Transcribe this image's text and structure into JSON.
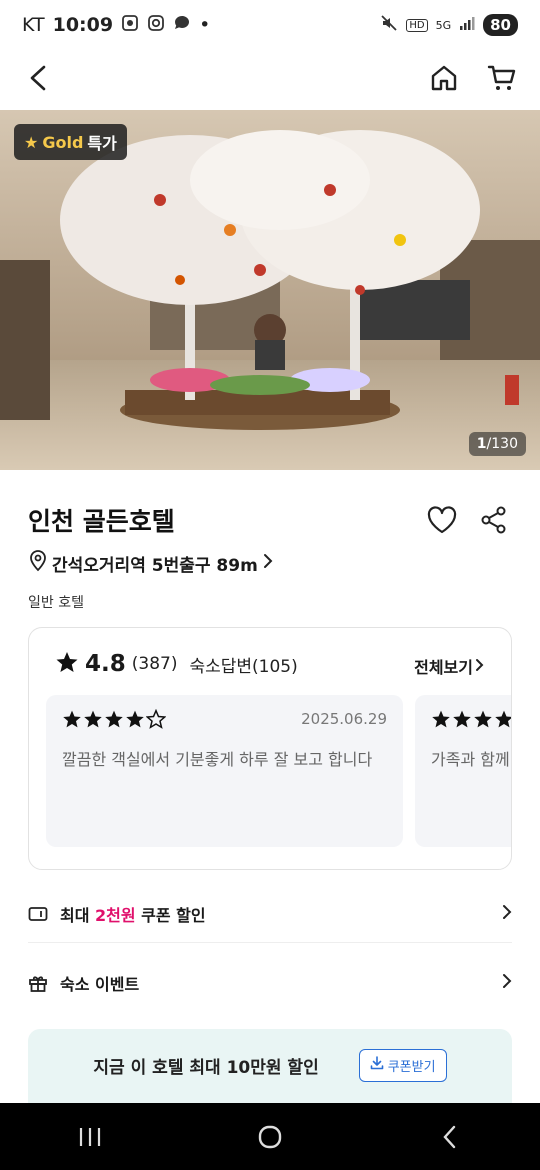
{
  "status_bar": {
    "carrier": "KT",
    "time": "10:09",
    "network": "5G",
    "hd": "HD",
    "battery": "80"
  },
  "nav": {
    "back_icon": "back-arrow-icon",
    "home_icon": "home-icon",
    "cart_icon": "cart-icon"
  },
  "hero": {
    "badge_gold": "Gold",
    "badge_special": "특가",
    "photo_current": "1",
    "photo_total": "/130"
  },
  "hotel": {
    "name": "인천 골든호텔",
    "location": "간석오거리역 5번출구 89m",
    "category": "일반 호텔"
  },
  "reviews": {
    "rating": "4.8",
    "count": "(387)",
    "reply": "숙소답변(105)",
    "see_all": "전체보기",
    "items": [
      {
        "stars": 4,
        "date": "2025.06.29",
        "text": "깔끔한 객실에서 기분좋게 하루 잘 보고 합니다"
      },
      {
        "stars": 4,
        "date": "",
        "text": "가족과 함께"
      }
    ]
  },
  "coupon_row": {
    "prefix": "최대 ",
    "highlight": "2천원",
    "suffix": " 쿠폰 할인"
  },
  "event_row": {
    "label": "숙소 이벤트"
  },
  "promo": {
    "text": "지금 이 호텔 최대 10만원 할인",
    "button": "쿠폰받기"
  },
  "colors": {
    "highlight": "#e0106b",
    "coupon_blue": "#2b6fd6",
    "promo_bg": "#e9f5f4"
  }
}
